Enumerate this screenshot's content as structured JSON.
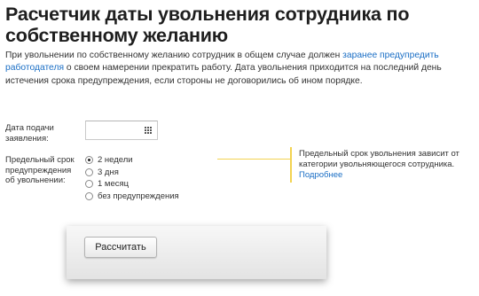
{
  "page": {
    "title": "Расчетчик даты увольнения сотрудника по собственному желанию",
    "intro_before": "При увольнении по собственному желанию сотрудник в общем случае должен ",
    "intro_link": "заранее предупредить работодателя",
    "intro_after": " о своем намерении прекратить работу. Дата увольнения приходится на последний день истечения срока предупреждения, если стороны не договорились об ином порядке."
  },
  "form": {
    "date_label": "Дата подачи заявления:",
    "date_value": "",
    "term_label": "Предельный срок предупреждения об увольнении:",
    "options": [
      {
        "label": "2 недели",
        "checked": true
      },
      {
        "label": "3 дня",
        "checked": false
      },
      {
        "label": "1 месяц",
        "checked": false
      },
      {
        "label": "без предупреждения",
        "checked": false
      }
    ],
    "hint_text": "Предельный срок увольнения зависит от категории увольняющегося сотрудника. ",
    "hint_link": "Подробнее",
    "calc_button": "Рассчитать"
  },
  "colors": {
    "link": "#1a6ec5",
    "hint_accent": "#f3d351"
  }
}
